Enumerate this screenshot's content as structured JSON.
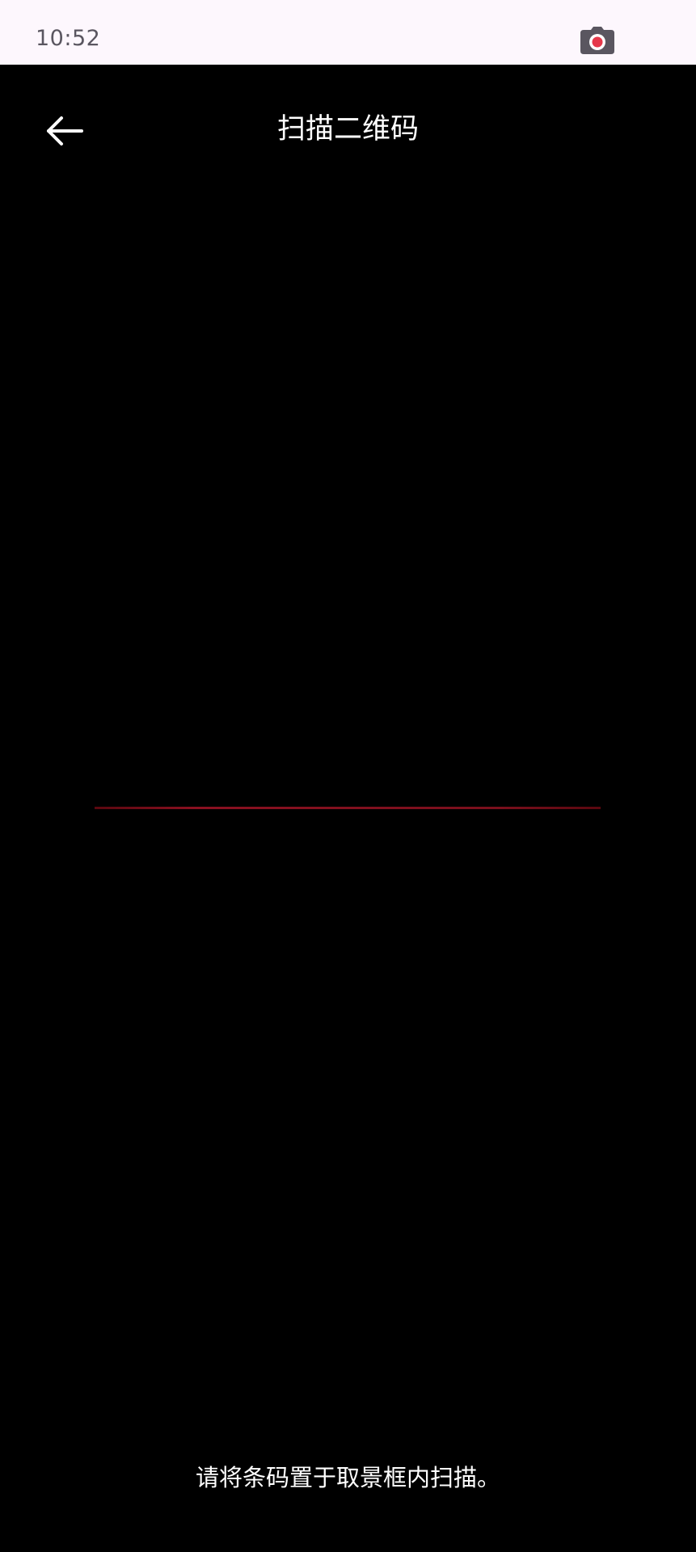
{
  "status_bar": {
    "time": "10:52",
    "icons": [
      "screen-record-camera-icon"
    ],
    "background": "#fdf7fd"
  },
  "app_bar": {
    "title": "扫描二维码",
    "back_icon": "arrow-left-icon"
  },
  "scanner": {
    "scan_line_color": "#8a1020",
    "hint": "请将条码置于取景框内扫描。"
  },
  "colors": {
    "background": "#000000",
    "text": "#ffffff"
  }
}
